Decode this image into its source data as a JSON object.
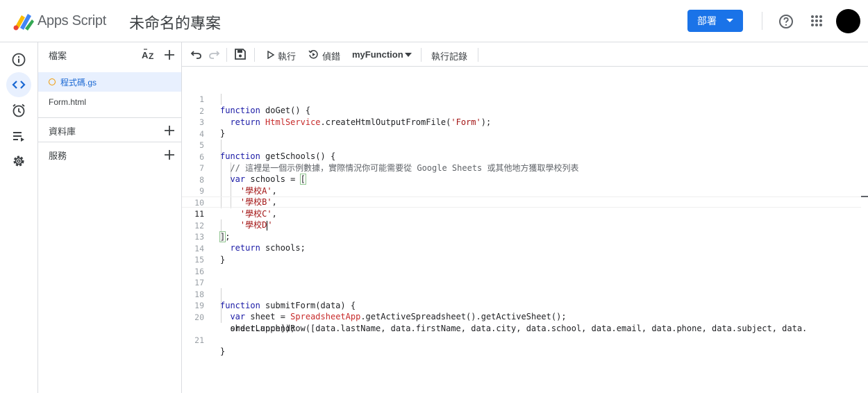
{
  "header": {
    "app_name": "Apps Script",
    "project_name": "未命名的專案",
    "deploy_label": "部署",
    "icons": [
      "apps-script-logo",
      "help-icon",
      "apps-grid-icon",
      "avatar"
    ]
  },
  "rail": {
    "items": [
      {
        "name": "overview",
        "icon": "info-icon"
      },
      {
        "name": "editor",
        "icon": "code-icon",
        "active": true
      },
      {
        "name": "triggers",
        "icon": "alarm-icon"
      },
      {
        "name": "executions",
        "icon": "executions-icon"
      },
      {
        "name": "settings",
        "icon": "gear-icon"
      }
    ]
  },
  "files": {
    "title": "檔案",
    "items": [
      {
        "label": "程式碼.gs",
        "active": true
      },
      {
        "label": "Form.html",
        "active": false
      }
    ],
    "sections": [
      {
        "label": "資料庫"
      },
      {
        "label": "服務"
      }
    ]
  },
  "toolbar": {
    "run_label": "執行",
    "debug_label": "偵錯",
    "function_selected": "myFunction",
    "log_label": "執行記錄"
  },
  "code": {
    "current_line": 11,
    "lines": [
      {
        "n": "1",
        "text": "function doGet() {"
      },
      {
        "n": "2",
        "text": "  return HtmlService.createHtmlOutputFromFile('Form');"
      },
      {
        "n": "3",
        "text": "}"
      },
      {
        "n": "4",
        "text": ""
      },
      {
        "n": "5",
        "text": "function getSchools() {"
      },
      {
        "n": "6",
        "text": "  // 這裡是一個示例數據，實際情況你可能需要從 Google Sheets 或其他地方獲取學校列表"
      },
      {
        "n": "7",
        "text": "  var schools = ["
      },
      {
        "n": "8",
        "text": "    '學校A',"
      },
      {
        "n": "9",
        "text": "    '學校B',"
      },
      {
        "n": "10",
        "text": "    '學校C',"
      },
      {
        "n": "11",
        "text": "    '學校D'"
      },
      {
        "n": "12",
        "text": "];"
      },
      {
        "n": "13",
        "text": "  return schools;"
      },
      {
        "n": "14",
        "text": "}"
      },
      {
        "n": "15",
        "text": ""
      },
      {
        "n": "16",
        "text": ""
      },
      {
        "n": "17",
        "text": ""
      },
      {
        "n": "18",
        "text": "function submitForm(data) {"
      },
      {
        "n": "19",
        "text": "  var sheet = SpreadsheetApp.getActiveSpreadsheet().getActiveSheet();"
      },
      {
        "n": "20",
        "text": "  sheet.appendRow([data.lastName, data.firstName, data.city, data.school, data.email, data.phone, data.subject, data."
      },
      {
        "n": "",
        "text": "  orderLunch]);"
      },
      {
        "n": "21",
        "text": "}"
      }
    ]
  },
  "colors": {
    "accent": "#1a73e8",
    "active_bg": "#e8f0fe",
    "active_text": "#1967d2",
    "keyword": "#1a1aa6",
    "string": "#a31515",
    "class": "#c72b2b",
    "file_dot": "#f29900"
  }
}
